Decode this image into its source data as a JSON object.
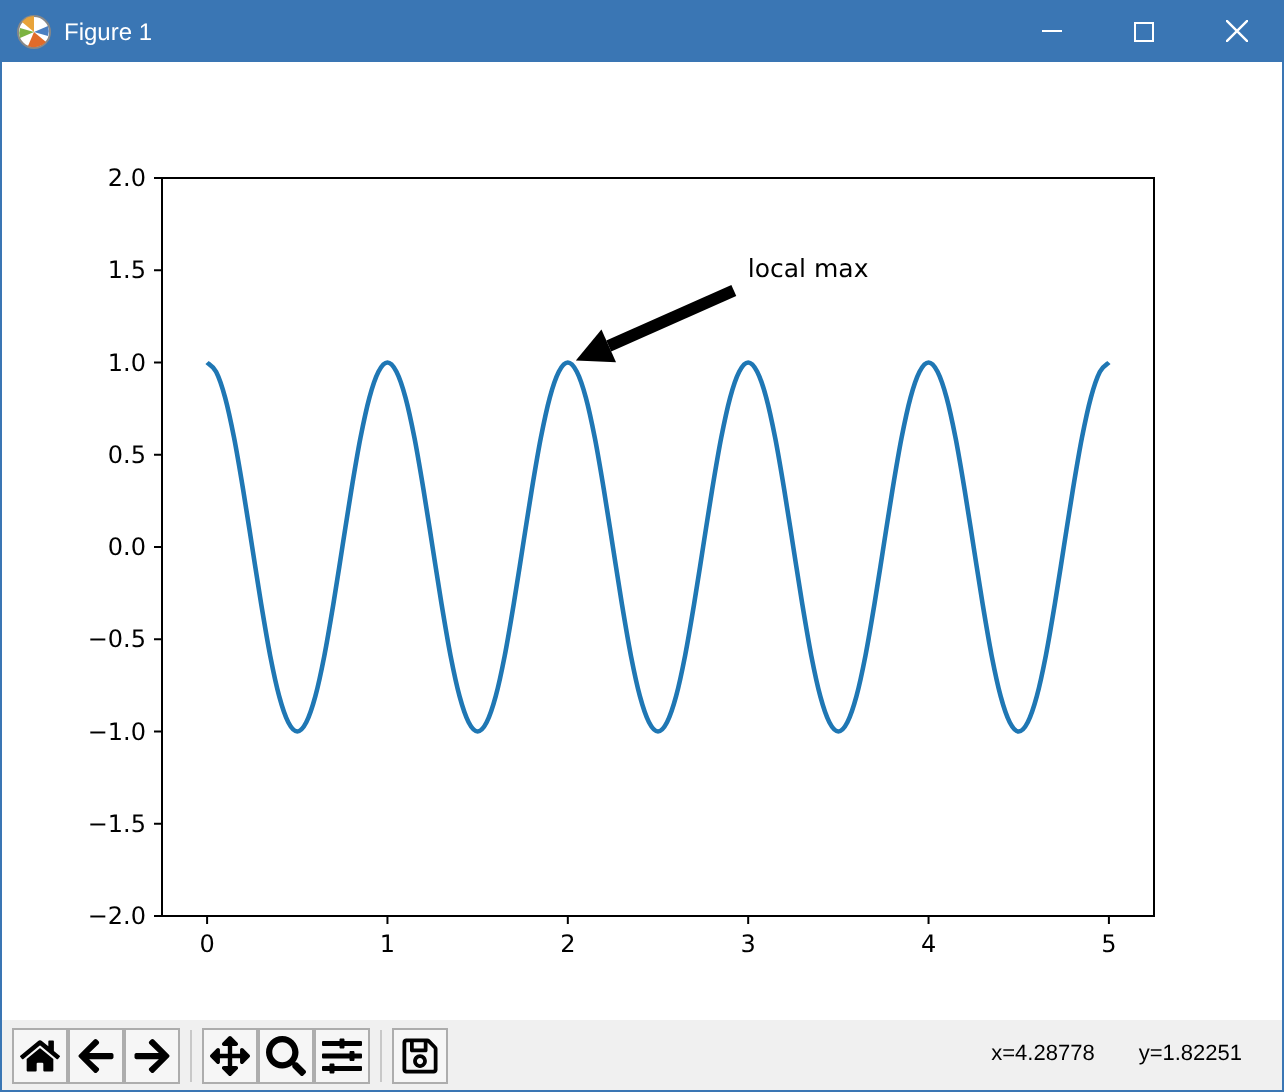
{
  "window": {
    "title": "Figure 1"
  },
  "figure": {
    "chart_data": {
      "type": "line",
      "x": [
        0,
        0.05,
        0.1,
        0.15,
        0.2,
        0.25,
        0.3,
        0.35,
        0.4,
        0.45,
        0.5,
        0.55,
        0.6,
        0.65,
        0.7,
        0.75,
        0.8,
        0.85,
        0.9,
        0.95,
        1,
        1.05,
        1.1,
        1.15,
        1.2,
        1.25,
        1.3,
        1.35,
        1.4,
        1.45,
        1.5,
        1.55,
        1.6,
        1.65,
        1.7,
        1.75,
        1.8,
        1.85,
        1.9,
        1.95,
        2,
        2.05,
        2.1,
        2.15,
        2.2,
        2.25,
        2.3,
        2.35,
        2.4,
        2.45,
        2.5,
        2.55,
        2.6,
        2.65,
        2.7,
        2.75,
        2.8,
        2.85,
        2.9,
        2.95,
        3,
        3.05,
        3.1,
        3.15,
        3.2,
        3.25,
        3.3,
        3.35,
        3.4,
        3.45,
        3.5,
        3.55,
        3.6,
        3.65,
        3.7,
        3.75,
        3.8,
        3.85,
        3.9,
        3.95,
        4,
        4.05,
        4.1,
        4.15,
        4.2,
        4.25,
        4.3,
        4.35,
        4.4,
        4.45,
        4.5,
        4.55,
        4.6,
        4.65,
        4.7,
        4.75,
        4.8,
        4.85,
        4.9,
        4.95,
        5
      ],
      "series": [
        {
          "color": "#1f77b4",
          "values": [
            1,
            0.95,
            0.81,
            0.59,
            0.31,
            0,
            -0.31,
            -0.59,
            -0.81,
            -0.95,
            -1,
            -0.95,
            -0.81,
            -0.59,
            -0.31,
            0,
            0.31,
            0.59,
            0.81,
            0.95,
            1,
            0.95,
            0.81,
            0.59,
            0.31,
            0,
            -0.31,
            -0.59,
            -0.81,
            -0.95,
            -1,
            -0.95,
            -0.81,
            -0.59,
            -0.31,
            0,
            0.31,
            0.59,
            0.81,
            0.95,
            1,
            0.95,
            0.81,
            0.59,
            0.31,
            0,
            -0.31,
            -0.59,
            -0.81,
            -0.95,
            -1,
            -0.95,
            -0.81,
            -0.59,
            -0.31,
            0,
            0.31,
            0.59,
            0.81,
            0.95,
            1,
            0.95,
            0.81,
            0.59,
            0.31,
            0,
            -0.31,
            -0.59,
            -0.81,
            -0.95,
            -1,
            -0.95,
            -0.81,
            -0.59,
            -0.31,
            0,
            0.31,
            0.59,
            0.81,
            0.95,
            1,
            0.95,
            0.81,
            0.59,
            0.31,
            0,
            -0.31,
            -0.59,
            -0.81,
            -0.95,
            -1,
            -0.95,
            -0.81,
            -0.59,
            -0.31,
            0,
            0.31,
            0.59,
            0.81,
            0.95,
            1
          ]
        }
      ],
      "xlim": [
        -0.25,
        5.25
      ],
      "ylim": [
        -2,
        2
      ],
      "xticks": [
        {
          "value": 0,
          "label": "0"
        },
        {
          "value": 1,
          "label": "1"
        },
        {
          "value": 2,
          "label": "2"
        },
        {
          "value": 3,
          "label": "3"
        },
        {
          "value": 4,
          "label": "4"
        },
        {
          "value": 5,
          "label": "5"
        }
      ],
      "yticks": [
        {
          "value": 2,
          "label": "2.0"
        },
        {
          "value": 1.5,
          "label": "1.5"
        },
        {
          "value": 1,
          "label": "1.0"
        },
        {
          "value": 0.5,
          "label": "0.5"
        },
        {
          "value": 0,
          "label": "0.0"
        },
        {
          "value": -0.5,
          "label": "−0.5"
        },
        {
          "value": -1,
          "label": "−1.0"
        },
        {
          "value": -1.5,
          "label": "−1.5"
        },
        {
          "value": -2,
          "label": "−2.0"
        }
      ],
      "annotations": [
        "local max"
      ]
    }
  },
  "toolbar": {
    "buttons": [
      {
        "kind": "home"
      },
      {
        "kind": "back"
      },
      {
        "kind": "forward"
      },
      {
        "kind": "separator"
      },
      {
        "kind": "pan"
      },
      {
        "kind": "zoom"
      },
      {
        "kind": "configure"
      },
      {
        "kind": "separator"
      },
      {
        "kind": "save"
      }
    ],
    "status": [
      "x=4.28778",
      "y=1.82251"
    ]
  }
}
